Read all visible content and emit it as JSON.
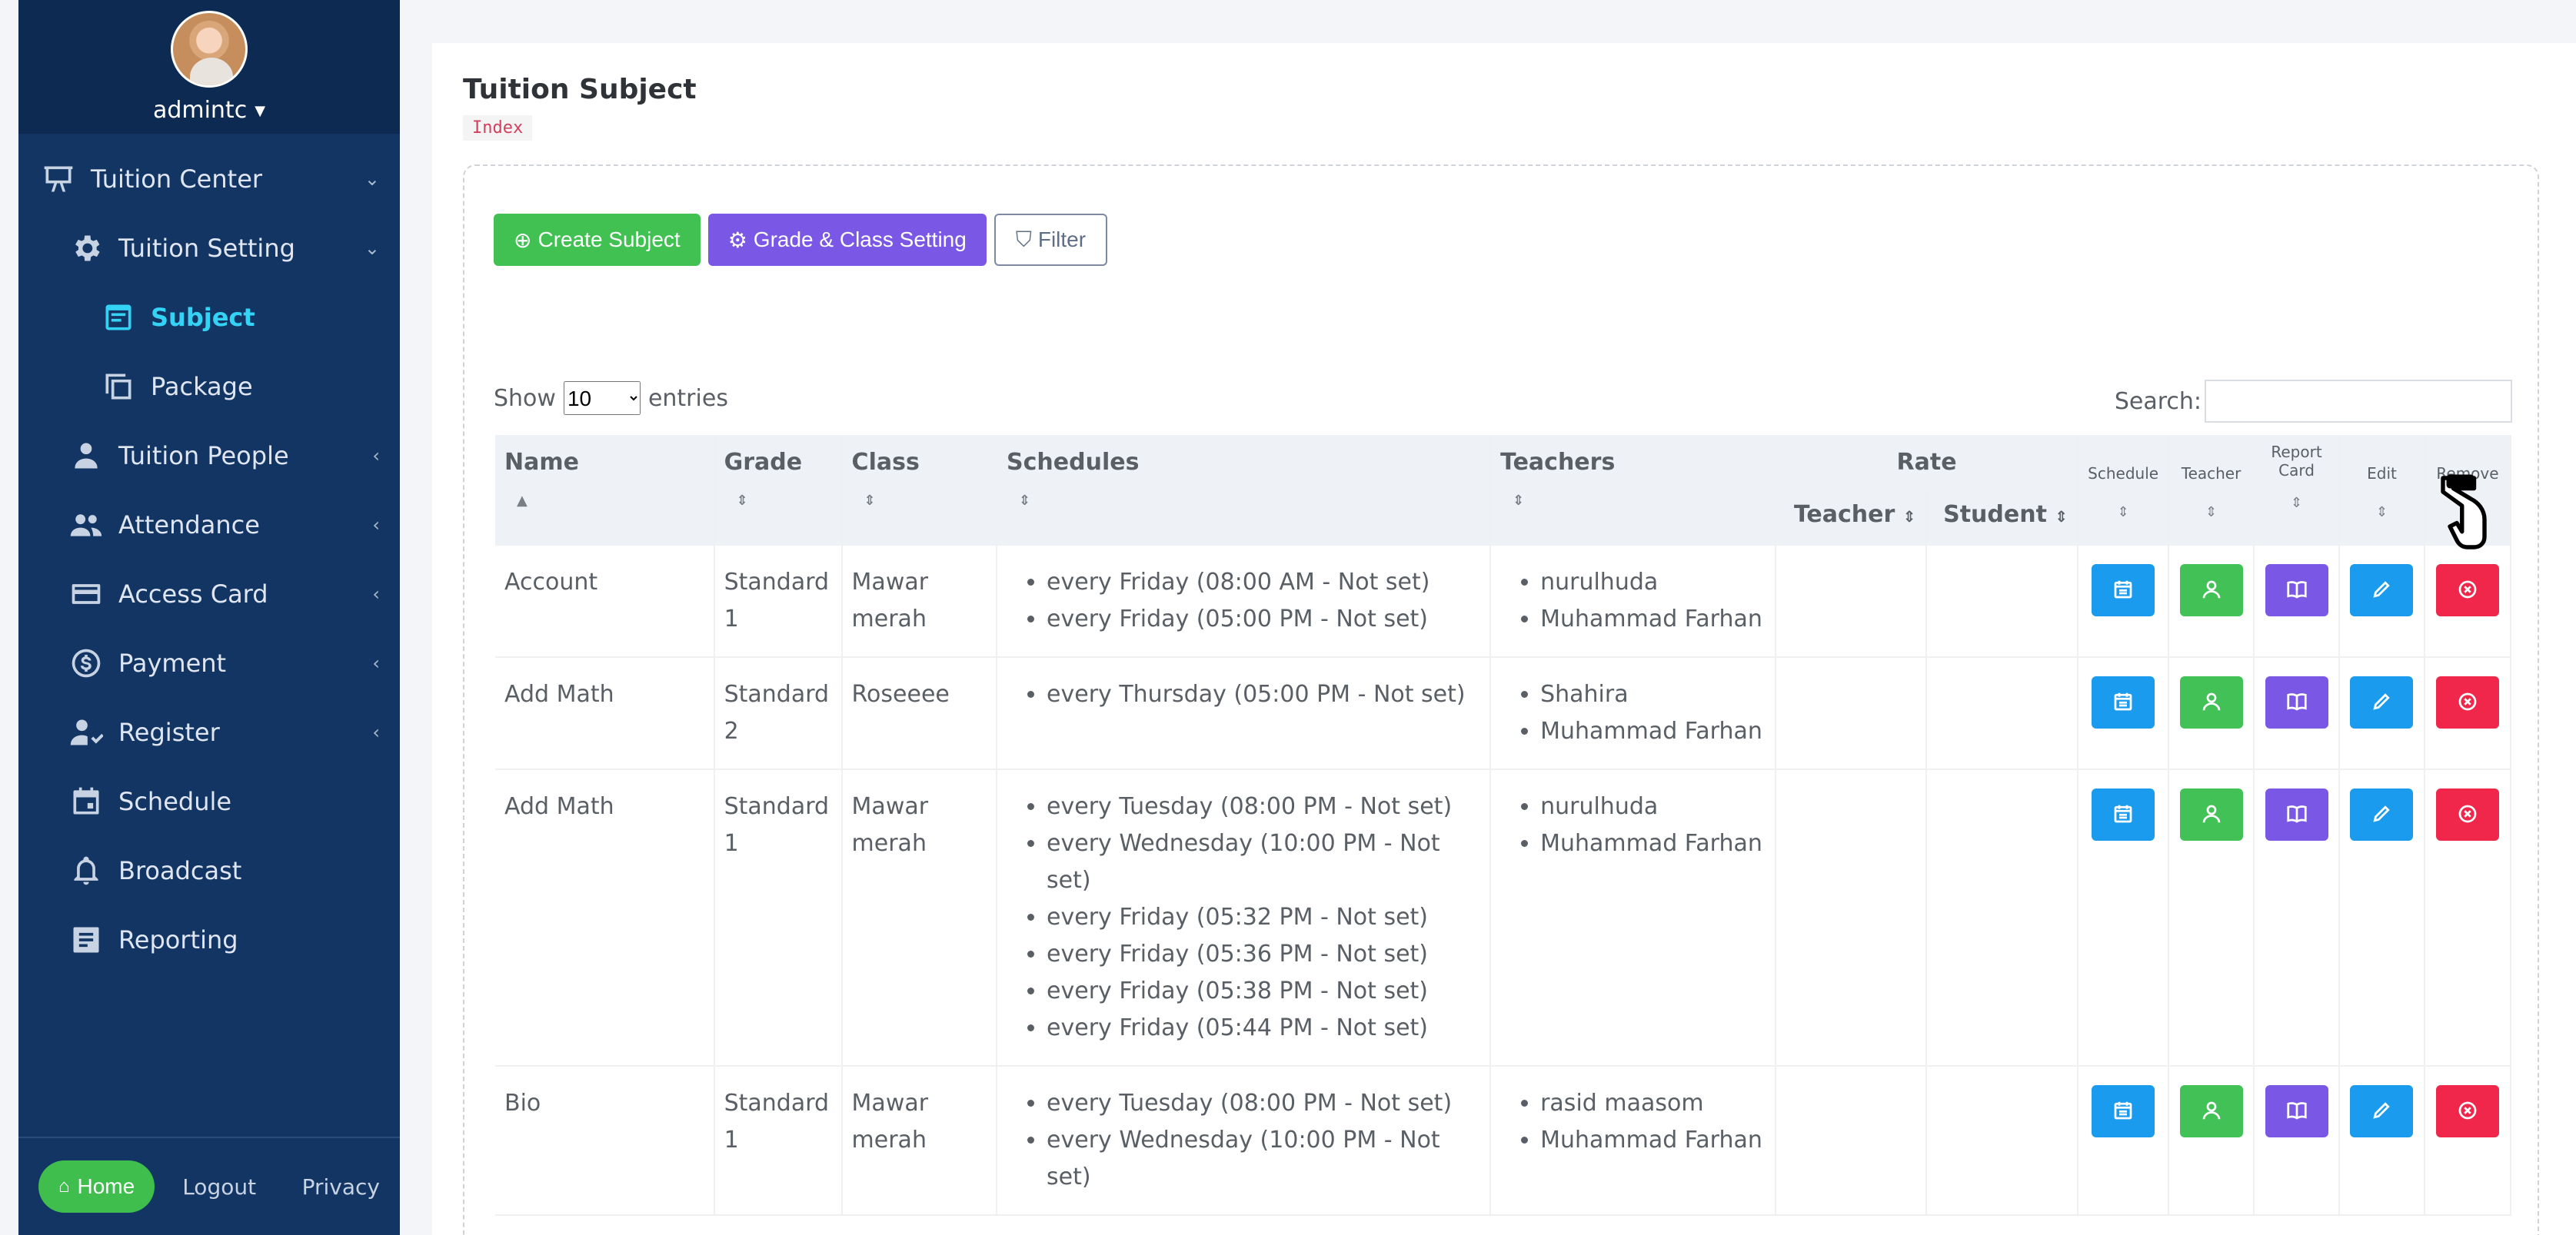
{
  "sidebar": {
    "username": "admintc",
    "items": [
      {
        "label": "Tuition Center",
        "icon": "presentation-board-icon",
        "arrow": "⌄",
        "level": 0
      },
      {
        "label": "Tuition Setting",
        "icon": "gear-icon",
        "arrow": "⌄",
        "level": 1
      },
      {
        "label": "Subject",
        "icon": "note-icon",
        "arrow": "",
        "level": 2,
        "active": true
      },
      {
        "label": "Package",
        "icon": "copy-icon",
        "arrow": "",
        "level": 2
      },
      {
        "label": "Tuition People",
        "icon": "person-icon",
        "arrow": "‹",
        "level": 1
      },
      {
        "label": "Attendance",
        "icon": "people-icon",
        "arrow": "‹",
        "level": 1
      },
      {
        "label": "Access Card",
        "icon": "credit-card-icon",
        "arrow": "‹",
        "level": 1
      },
      {
        "label": "Payment",
        "icon": "dollar-icon",
        "arrow": "‹",
        "level": 1
      },
      {
        "label": "Register",
        "icon": "person-check-icon",
        "arrow": "‹",
        "level": 1
      },
      {
        "label": "Schedule",
        "icon": "calendar-icon",
        "arrow": "",
        "level": 1
      },
      {
        "label": "Broadcast",
        "icon": "bell-icon",
        "arrow": "",
        "level": 1
      },
      {
        "label": "Reporting",
        "icon": "report-icon",
        "arrow": "",
        "level": 1
      }
    ],
    "footer": {
      "home": "Home",
      "logout": "Logout",
      "privacy": "Privacy"
    }
  },
  "page": {
    "title": "Tuition Subject",
    "breadcrumb": "Index",
    "buttons": {
      "create": "Create Subject",
      "grade": "Grade & Class Setting",
      "filter": "Filter"
    },
    "show_label": "Show",
    "entries_value": "10",
    "entries_label": "entries",
    "search_label": "Search:"
  },
  "table": {
    "headers": {
      "name": "Name",
      "grade": "Grade",
      "class": "Class",
      "schedules": "Schedules",
      "teachers": "Teachers",
      "rate": "Rate",
      "rate_teacher": "Teacher",
      "rate_student": "Student",
      "schedule": "Schedule",
      "teacher": "Teacher",
      "report_card": "Report Card",
      "edit": "Edit",
      "remove": "Remove"
    },
    "rows": [
      {
        "name": "Account",
        "grade": "Standard 1",
        "class": "Mawar merah",
        "schedules": [
          "every Friday (08:00 AM - Not set)",
          "every Friday (05:00 PM - Not set)"
        ],
        "teachers": [
          "nurulhuda",
          "Muhammad Farhan"
        ]
      },
      {
        "name": "Add Math",
        "grade": "Standard 2",
        "class": "Roseeee",
        "schedules": [
          "every Thursday (05:00 PM - Not set)"
        ],
        "teachers": [
          "Shahira",
          "Muhammad Farhan"
        ]
      },
      {
        "name": "Add Math",
        "grade": "Standard 1",
        "class": "Mawar merah",
        "schedules": [
          "every Tuesday (08:00 PM - Not set)",
          "every Wednesday (10:00 PM - Not set)",
          "every Friday (05:32 PM - Not set)",
          "every Friday (05:36 PM - Not set)",
          "every Friday (05:38 PM - Not set)",
          "every Friday (05:44 PM - Not set)"
        ],
        "teachers": [
          "nurulhuda",
          "Muhammad Farhan"
        ]
      },
      {
        "name": "Bio",
        "grade": "Standard 1",
        "class": "Mawar merah",
        "schedules": [
          "every Tuesday (08:00 PM - Not set)",
          "every Wednesday (10:00 PM - Not set)"
        ],
        "teachers": [
          "rasid maasom",
          "Muhammad Farhan"
        ]
      }
    ]
  },
  "colors": {
    "sidebar": "#123563",
    "accent": "#34d3f5",
    "green": "#41c152",
    "purple": "#7b57e5",
    "blue": "#1a9bee",
    "red": "#f0264b"
  }
}
